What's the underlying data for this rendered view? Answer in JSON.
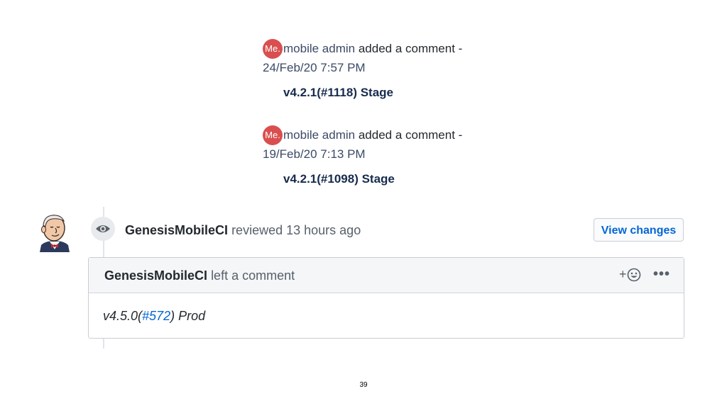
{
  "comments": [
    {
      "avatar_initials": "Me.",
      "author": "mobile admin",
      "action": "added a comment -",
      "date": "24/Feb/20 7:57 PM",
      "body": "v4.2.1(#1118) Stage"
    },
    {
      "avatar_initials": "Me.",
      "author": "mobile admin",
      "action": "added a comment -",
      "date": "19/Feb/20 7:13 PM",
      "body": "v4.2.1(#1098) Stage"
    }
  ],
  "review": {
    "reviewer": "GenesisMobileCI",
    "action": "reviewed",
    "time": "13 hours ago",
    "view_changes_label": "View changes",
    "comment_author": "GenesisMobileCI",
    "comment_action": "left a comment",
    "reaction_plus": "+",
    "menu_dots": "•••",
    "body_prefix": "v4.5.0(",
    "body_link": "#572",
    "body_suffix": ") Prod"
  },
  "page_number": "39",
  "colors": {
    "avatar_bg": "#d94f4f",
    "link": "#0366d6",
    "header_bg": "#f4f6f8"
  },
  "icons": [
    "eye-icon",
    "smiley-icon",
    "jenkins-avatar"
  ]
}
